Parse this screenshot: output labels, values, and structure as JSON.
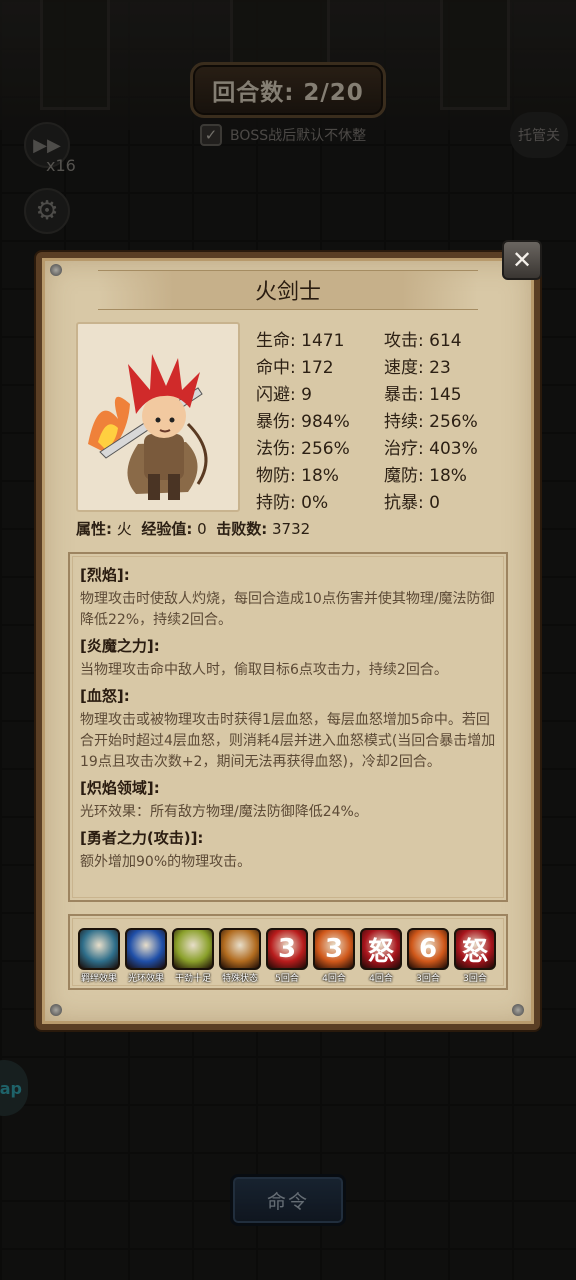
{
  "hud": {
    "round_label": "回合数: 2/20",
    "boss_checkbox_label": "BOSS战后默认不休整",
    "boss_checked": true,
    "speed_label": "x16",
    "auto_label": "托管关",
    "side_tab_label": "ap",
    "command_label": "命令"
  },
  "panel": {
    "title": "火剑士",
    "stats": [
      {
        "label": "生命",
        "value": "1471"
      },
      {
        "label": "攻击",
        "value": "614"
      },
      {
        "label": "命中",
        "value": "172"
      },
      {
        "label": "速度",
        "value": "23"
      },
      {
        "label": "闪避",
        "value": "9"
      },
      {
        "label": "暴击",
        "value": "145"
      },
      {
        "label": "暴伤",
        "value": "984%"
      },
      {
        "label": "持续",
        "value": "256%"
      },
      {
        "label": "法伤",
        "value": "256%"
      },
      {
        "label": "治疗",
        "value": "403%"
      },
      {
        "label": "物防",
        "value": "18%"
      },
      {
        "label": "魔防",
        "value": "18%"
      },
      {
        "label": "持防",
        "value": "0%"
      },
      {
        "label": "抗暴",
        "value": "0"
      }
    ],
    "info": {
      "attr_label": "属性:",
      "attr_value": "火",
      "exp_label": "经验值:",
      "exp_value": "0",
      "kills_label": "击败数:",
      "kills_value": "3732"
    },
    "skills": [
      {
        "name": "[烈焰]:",
        "desc": "物理攻击时使敌人灼烧，每回合造成10点伤害并使其物理/魔法防御降低22%，持续2回合。"
      },
      {
        "name": "[炎魔之力]:",
        "desc": "当物理攻击命中敌人时，偷取目标6点攻击力，持续2回合。"
      },
      {
        "name": "[血怒]:",
        "desc": "物理攻击或被物理攻击时获得1层血怒，每层血怒增加5命中。若回合开始时超过4层血怒，则消耗4层并进入血怒模式(当回合暴击增加19点且攻击次数+2，期间无法再获得血怒)，冷却2回合。"
      },
      {
        "name": "[炽焰领域]:",
        "desc": "光环效果：所有敌方物理/魔法防御降低24%。"
      },
      {
        "name": "[勇者之力(攻击)]:",
        "desc": "额外增加90%的物理攻击。"
      }
    ],
    "statuses": [
      {
        "glyph": "",
        "label": "羁绊效果",
        "color": "#2e6e8a"
      },
      {
        "glyph": "",
        "label": "光环效果",
        "color": "#1f4fa8"
      },
      {
        "glyph": "",
        "label": "干劲十足",
        "color": "#8aa02a"
      },
      {
        "glyph": "",
        "label": "特殊状态",
        "color": "#b06a1e"
      },
      {
        "glyph": "3",
        "label": "5回合",
        "color": "#b81c1c"
      },
      {
        "glyph": "3",
        "label": "4回合",
        "color": "#d0581a"
      },
      {
        "glyph": "怒",
        "label": "4回合",
        "color": "#a8141c"
      },
      {
        "glyph": "6",
        "label": "3回合",
        "color": "#d0581a"
      },
      {
        "glyph": "怒",
        "label": "3回合",
        "color": "#a8141c"
      }
    ]
  }
}
